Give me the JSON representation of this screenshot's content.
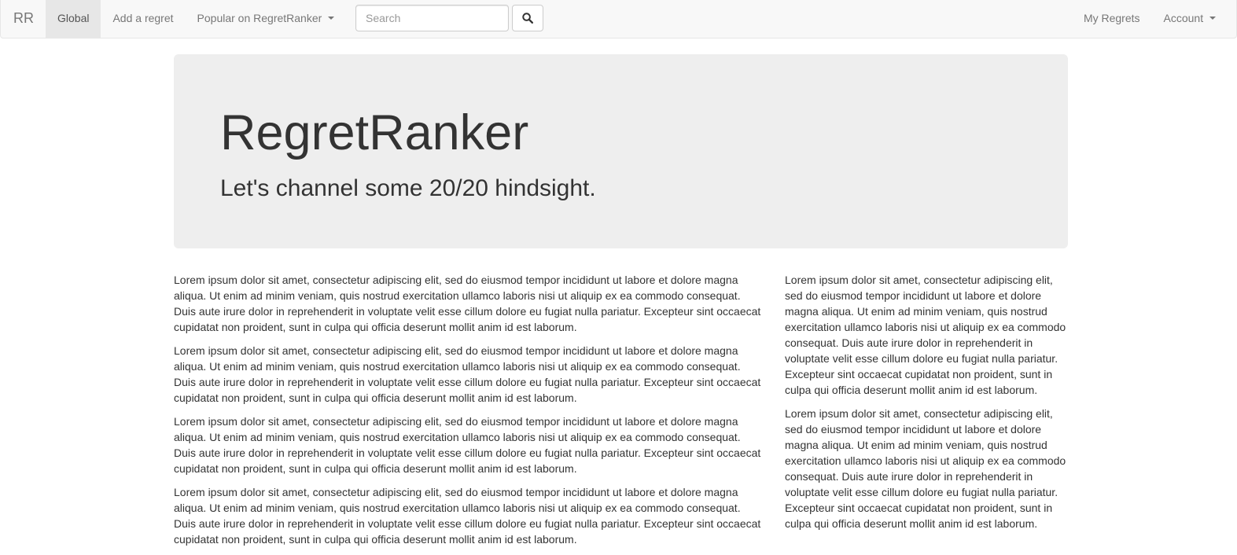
{
  "navbar": {
    "brand": "RR",
    "left_items": [
      {
        "label": "Global",
        "active": true
      },
      {
        "label": "Add a regret",
        "active": false
      },
      {
        "label": "Popular on RegretRanker",
        "active": false,
        "dropdown": true
      }
    ],
    "search": {
      "placeholder": "Search",
      "value": "",
      "button_icon": "search-icon"
    },
    "right_items": [
      {
        "label": "My Regrets",
        "dropdown": false
      },
      {
        "label": "Account",
        "dropdown": true
      }
    ]
  },
  "jumbotron": {
    "title": "RegretRanker",
    "subtitle": "Let's channel some 20/20 hindsight."
  },
  "content": {
    "left_paragraphs": [
      "Lorem ipsum dolor sit amet, consectetur adipiscing elit, sed do eiusmod tempor incididunt ut labore et dolore magna aliqua. Ut enim ad minim veniam, quis nostrud exercitation ullamco laboris nisi ut aliquip ex ea commodo consequat. Duis aute irure dolor in reprehenderit in voluptate velit esse cillum dolore eu fugiat nulla pariatur. Excepteur sint occaecat cupidatat non proident, sunt in culpa qui officia deserunt mollit anim id est laborum.",
      "Lorem ipsum dolor sit amet, consectetur adipiscing elit, sed do eiusmod tempor incididunt ut labore et dolore magna aliqua. Ut enim ad minim veniam, quis nostrud exercitation ullamco laboris nisi ut aliquip ex ea commodo consequat. Duis aute irure dolor in reprehenderit in voluptate velit esse cillum dolore eu fugiat nulla pariatur. Excepteur sint occaecat cupidatat non proident, sunt in culpa qui officia deserunt mollit anim id est laborum.",
      "Lorem ipsum dolor sit amet, consectetur adipiscing elit, sed do eiusmod tempor incididunt ut labore et dolore magna aliqua. Ut enim ad minim veniam, quis nostrud exercitation ullamco laboris nisi ut aliquip ex ea commodo consequat. Duis aute irure dolor in reprehenderit in voluptate velit esse cillum dolore eu fugiat nulla pariatur. Excepteur sint occaecat cupidatat non proident, sunt in culpa qui officia deserunt mollit anim id est laborum.",
      "Lorem ipsum dolor sit amet, consectetur adipiscing elit, sed do eiusmod tempor incididunt ut labore et dolore magna aliqua. Ut enim ad minim veniam, quis nostrud exercitation ullamco laboris nisi ut aliquip ex ea commodo consequat. Duis aute irure dolor in reprehenderit in voluptate velit esse cillum dolore eu fugiat nulla pariatur. Excepteur sint occaecat cupidatat non proident, sunt in culpa qui officia deserunt mollit anim id est laborum."
    ],
    "right_paragraphs": [
      "Lorem ipsum dolor sit amet, consectetur adipiscing elit, sed do eiusmod tempor incididunt ut labore et dolore magna aliqua. Ut enim ad minim veniam, quis nostrud exercitation ullamco laboris nisi ut aliquip ex ea commodo consequat. Duis aute irure dolor in reprehenderit in voluptate velit esse cillum dolore eu fugiat nulla pariatur. Excepteur sint occaecat cupidatat non proident, sunt in culpa qui officia deserunt mollit anim id est laborum.",
      "Lorem ipsum dolor sit amet, consectetur adipiscing elit, sed do eiusmod tempor incididunt ut labore et dolore magna aliqua. Ut enim ad minim veniam, quis nostrud exercitation ullamco laboris nisi ut aliquip ex ea commodo consequat. Duis aute irure dolor in reprehenderit in voluptate velit esse cillum dolore eu fugiat nulla pariatur. Excepteur sint occaecat cupidatat non proident, sunt in culpa qui officia deserunt mollit anim id est laborum."
    ]
  }
}
